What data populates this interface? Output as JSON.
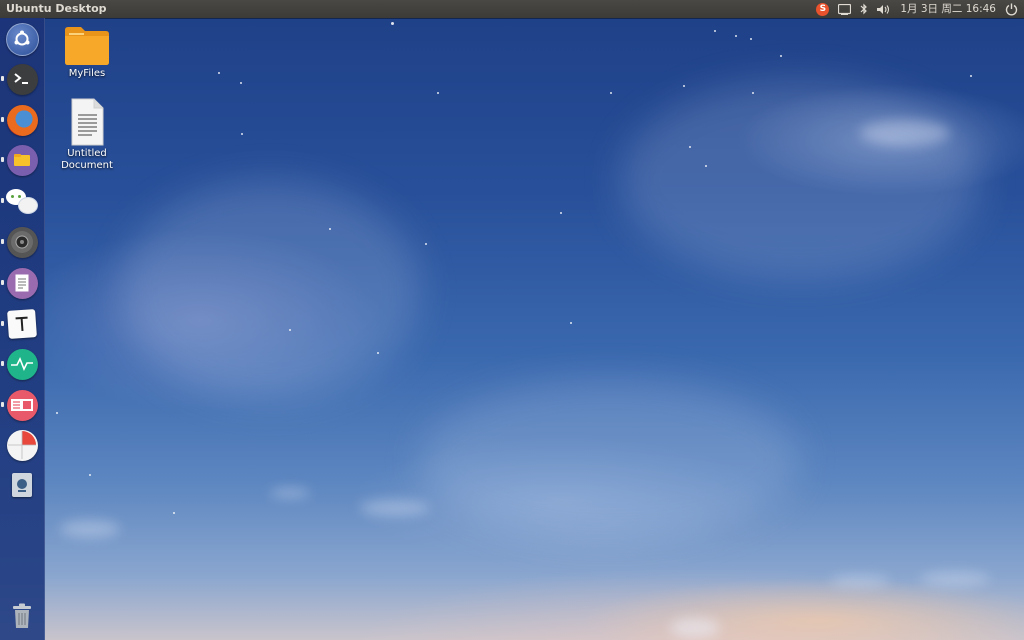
{
  "top_panel": {
    "title": "Ubuntu Desktop",
    "indicators": {
      "sogou_label": "S",
      "keyboard_icon": "keyboard-icon",
      "bluetooth_icon": "bluetooth-icon",
      "volume_icon": "volume-icon",
      "clock": "1月 3日 周二 16:46",
      "power_icon": "power-icon"
    }
  },
  "launcher": {
    "items": [
      {
        "name": "dash-icon",
        "running": false
      },
      {
        "name": "terminal-icon",
        "running": true
      },
      {
        "name": "firefox-icon",
        "running": true
      },
      {
        "name": "files-icon",
        "running": true
      },
      {
        "name": "wechat-icon",
        "running": true
      },
      {
        "name": "disc-icon",
        "running": true
      },
      {
        "name": "text-editor-icon",
        "running": true
      },
      {
        "name": "typora-icon",
        "running": true
      },
      {
        "name": "system-monitor-icon",
        "running": true
      },
      {
        "name": "presentation-icon",
        "running": true
      },
      {
        "name": "disk-usage-icon",
        "running": false
      },
      {
        "name": "vlc-icon",
        "running": false
      },
      {
        "name": "trash-icon",
        "running": false
      }
    ]
  },
  "desktop": {
    "icons": [
      {
        "label": "MyFiles",
        "icon": "folder-icon"
      },
      {
        "label": "Untitled\nDocument",
        "icon": "document-icon"
      }
    ]
  },
  "colors": {
    "panel_bg": "#3c3b37",
    "panel_text": "#dfdbd2",
    "launcher_bg": "#1c3478",
    "folder_orange": "#f5a623",
    "sky_top": "#1e3f86",
    "horizon": "#c9c4cc"
  }
}
